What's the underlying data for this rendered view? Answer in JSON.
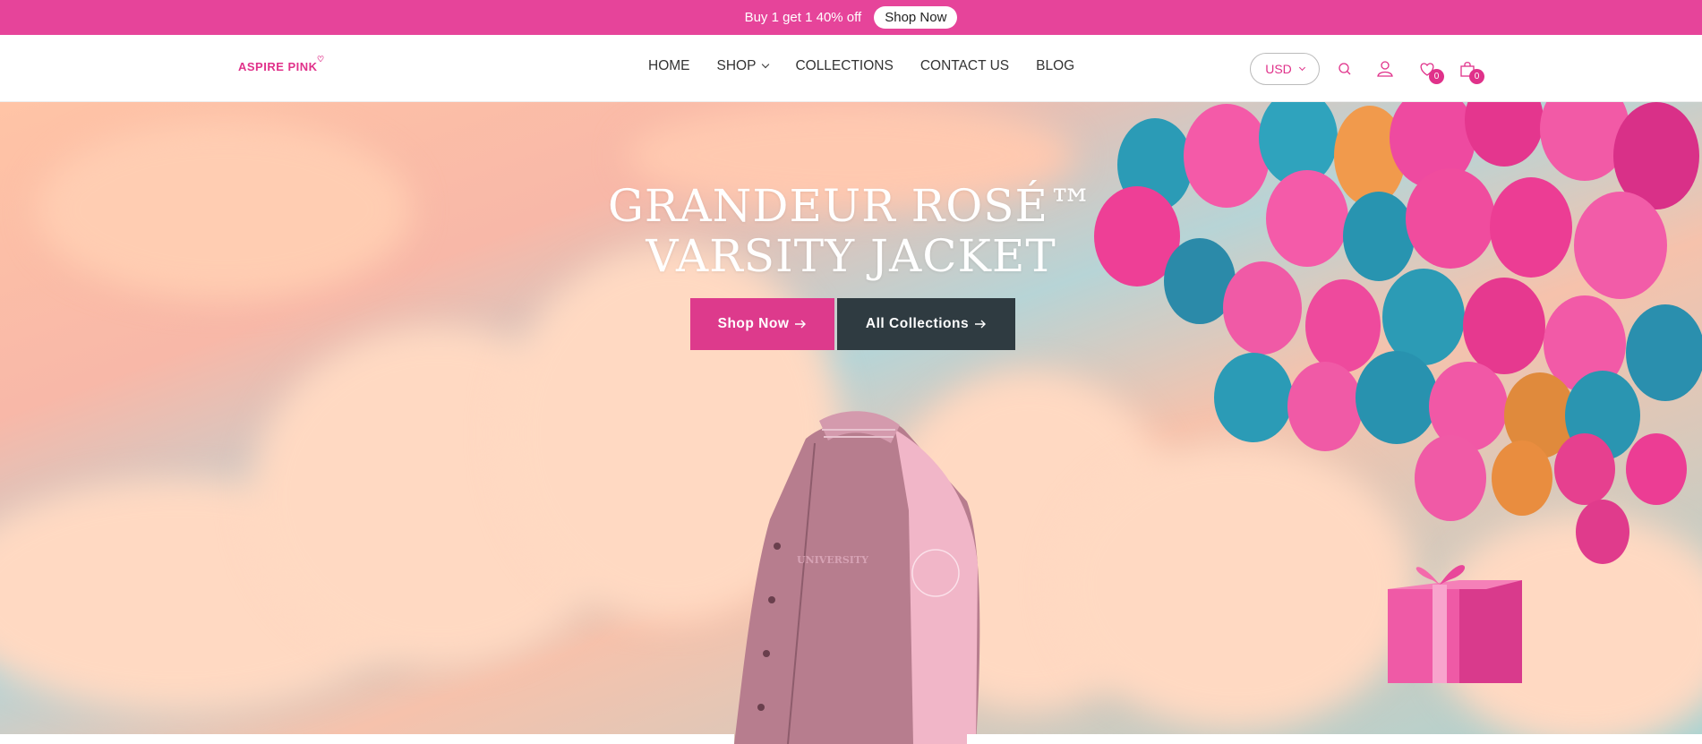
{
  "announcement": {
    "text": "Buy 1 get 1 40% off",
    "button_label": "Shop Now"
  },
  "header": {
    "logo_text": "ASPIRE PINK",
    "nav": [
      {
        "label": "HOME"
      },
      {
        "label": "SHOP"
      },
      {
        "label": "COLLECTIONS"
      },
      {
        "label": "CONTACT US"
      },
      {
        "label": "BLOG"
      }
    ],
    "currency": "USD",
    "wishlist_count": "0",
    "cart_count": "0"
  },
  "hero": {
    "title_line1": "GRANDEUR ROSÉ™",
    "title_line2": "VARSITY JACKET",
    "primary_button": "Shop Now",
    "secondary_button": "All Collections",
    "jacket_text": "UNIVERSITY"
  },
  "colors": {
    "brand_pink": "#e6449a",
    "button_pink": "#dd3a8c",
    "button_dark": "#2f3b41"
  },
  "icons": [
    "search-icon",
    "user-icon",
    "heart-icon",
    "bag-icon",
    "arrow-right-icon",
    "chevron-down-icon"
  ]
}
